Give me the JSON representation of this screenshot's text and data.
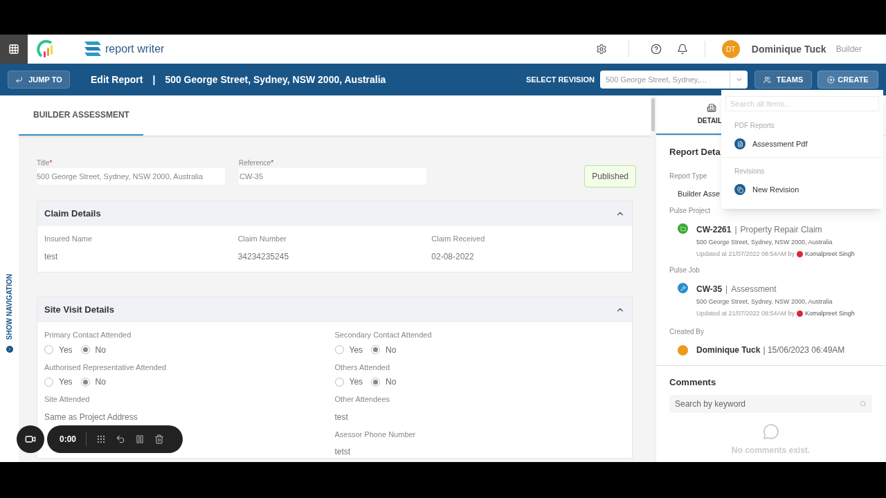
{
  "header": {
    "logo_text": "report writer",
    "user": {
      "initials": "DT",
      "name": "Dominique Tuck",
      "role": "Builder"
    }
  },
  "toolbar": {
    "jump": "JUMP TO",
    "title": "Edit Report",
    "separator": "|",
    "address": "500 George Street, Sydney, NSW 2000, Australia",
    "revision_label": "SELECT REVISION",
    "revision_value": "500 George Street, Sydney,…",
    "teams": "TEAMS",
    "create": "CREATE"
  },
  "create_menu": {
    "placeholder": "Search all items...",
    "groups": [
      {
        "heading": "PDF Reports",
        "items": [
          {
            "label": "Assessment Pdf",
            "kind": "pdf"
          }
        ]
      },
      {
        "heading": "Revisions",
        "items": [
          {
            "label": "New Revision",
            "kind": "revision"
          }
        ]
      }
    ]
  },
  "side_nav": "SHOW NAVIGATION",
  "main": {
    "tabs": [
      {
        "label": "BUILDER ASSESSMENT",
        "selected": true
      }
    ],
    "title_field": {
      "label": "Title",
      "required": "*",
      "value": "500 George Street, Sydney, NSW 2000, Australia"
    },
    "reference_field": {
      "label": "Reference",
      "required": "*",
      "value": "CW-35"
    },
    "status": "Published",
    "claim": {
      "heading": "Claim Details",
      "expanded": true,
      "fields": [
        {
          "label": "Insured Name",
          "value": "test"
        },
        {
          "label": "Claim Number",
          "value": "34234235245"
        },
        {
          "label": "Claim Received",
          "value": "02-08-2022"
        }
      ]
    },
    "site_visit": {
      "heading": "Site Visit Details",
      "expanded": true,
      "radios": [
        {
          "label": "Primary Contact Attended",
          "options": [
            {
              "label": "Yes",
              "selected": false
            },
            {
              "label": "No",
              "selected": true
            }
          ]
        },
        {
          "label": "Secondary Contact Attended",
          "options": [
            {
              "label": "Yes",
              "selected": false
            },
            {
              "label": "No",
              "selected": true
            }
          ]
        },
        {
          "label": "Authorised Representative Attended",
          "options": [
            {
              "label": "Yes",
              "selected": false
            },
            {
              "label": "No",
              "selected": true
            }
          ]
        },
        {
          "label": "Others Attended",
          "options": [
            {
              "label": "Yes",
              "selected": false
            },
            {
              "label": "No",
              "selected": true
            }
          ]
        }
      ],
      "fields": [
        {
          "label": "Site Attended",
          "value": "Same as Project Address"
        },
        {
          "label": "Other Attendees",
          "value": "test"
        },
        {
          "label": "Asessor Phone Number",
          "value": "tetst"
        }
      ]
    }
  },
  "details": {
    "tab": {
      "label": "DETAIL",
      "selected": true
    },
    "heading": "Report Deta",
    "report_type_label": "Report Type",
    "report_type": "Builder Asse",
    "links": [
      {
        "section": "Pulse Project",
        "code": "CW-2261",
        "separator": "|",
        "name": "Property Repair Claim",
        "address": "500 George Street, Sydney, NSW 2000, Australia",
        "updated": "Updated at 21/07/2022 08:54AM by",
        "user": "Komalpreet Singh",
        "color": "#3aab2e"
      },
      {
        "section": "Pulse Job",
        "code": "CW-35",
        "separator": "|",
        "name": "Assessment",
        "address": "500 George Street, Sydney, NSW 2000, Australia",
        "updated": "Updated at 21/07/2022 08:54AM by",
        "user": "Komalpreet Singh",
        "color": "#2a8bd1"
      }
    ],
    "created_label": "Created By",
    "created_name": "Dominique Tuck",
    "created_date": "| 15/06/2023 06:49AM"
  },
  "comments": {
    "heading": "Comments",
    "placeholder": "Search by keyword",
    "empty": "No comments exist."
  },
  "recorder": {
    "time": "0:00"
  }
}
